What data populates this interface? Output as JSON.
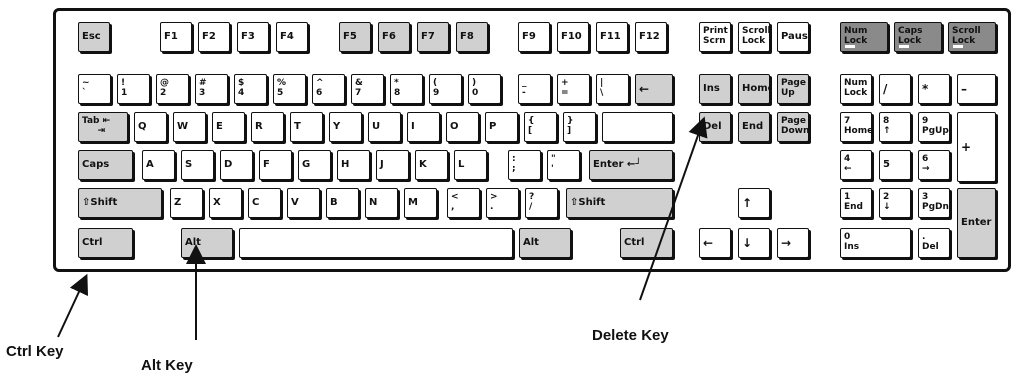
{
  "callouts": {
    "ctrl": "Ctrl Key",
    "alt": "Alt Key",
    "delete": "Delete Key"
  },
  "keys": {
    "esc": "Esc",
    "f1": "F1",
    "f2": "F2",
    "f3": "F3",
    "f4": "F4",
    "f5": "F5",
    "f6": "F6",
    "f7": "F7",
    "f8": "F8",
    "f9": "F9",
    "f10": "F10",
    "f11": "F11",
    "f12": "F12",
    "print_screen": "Print\nScrn",
    "scroll_lock": "Scroll\nLock",
    "pause": "Pause",
    "num_lock_led": "Num\nLock",
    "caps_lock_led": "Caps\nLock",
    "scroll_lock_led": "Scroll\nLock",
    "tilde": "~\n`",
    "k1": "!\n1",
    "k2": "@\n2",
    "k3": "#\n3",
    "k4": "$\n4",
    "k5": "%\n5",
    "k6": "^\n6",
    "k7": "&\n7",
    "k8": "*\n8",
    "k9": "(\n9",
    "k0": ")\n0",
    "minus": "_\n-",
    "equals": "+\n=",
    "pipe": "|\n\\",
    "backspace": "←",
    "ins": "Ins",
    "home": "Home",
    "page_up": "Page\nUp",
    "numpad_numlock": "Num\nLock",
    "numpad_slash": "/",
    "numpad_star": "*",
    "numpad_minus": "–",
    "tab": "Tab ⇤\n     ⇥",
    "q": "Q",
    "w": "W",
    "e": "E",
    "r": "R",
    "t": "T",
    "y": "Y",
    "u": "U",
    "i": "I",
    "o": "O",
    "p": "P",
    "lbrace": "{\n[",
    "rbrace": "}\n]",
    "del": "Del",
    "end": "End",
    "page_down": "Page\nDown",
    "np7": "7\nHome",
    "np8": "8\n↑",
    "np9": "9\nPgUp",
    "numpad_plus": "+",
    "caps": "Caps",
    "a": "A",
    "s": "S",
    "d": "D",
    "f": "F",
    "g": "G",
    "h": "H",
    "j": "J",
    "k": "K",
    "l": "L",
    "semicolon": ":\n;",
    "quote": "\"\n'",
    "enter": "Enter ←┘",
    "np4": "4\n←",
    "np5": "5",
    "np6": "6\n→",
    "lshift": "⇧Shift",
    "z": "Z",
    "x": "X",
    "c": "C",
    "v": "V",
    "b": "B",
    "n": "N",
    "m": "M",
    "comma": "<\n,",
    "period": ">\n.",
    "slash": "?\n/",
    "rshift": "⇧Shift",
    "arrow_up": "↑",
    "np1": "1\nEnd",
    "np2": "2\n↓",
    "np3": "3\nPgDn",
    "numpad_enter": "Enter",
    "lctrl": "Ctrl",
    "lalt": "Alt",
    "space": "",
    "ralt": "Alt",
    "rctrl": "Ctrl",
    "arrow_left": "←",
    "arrow_down": "↓",
    "arrow_right": "→",
    "np0": "0\nIns",
    "np_dot": ".\nDel"
  }
}
